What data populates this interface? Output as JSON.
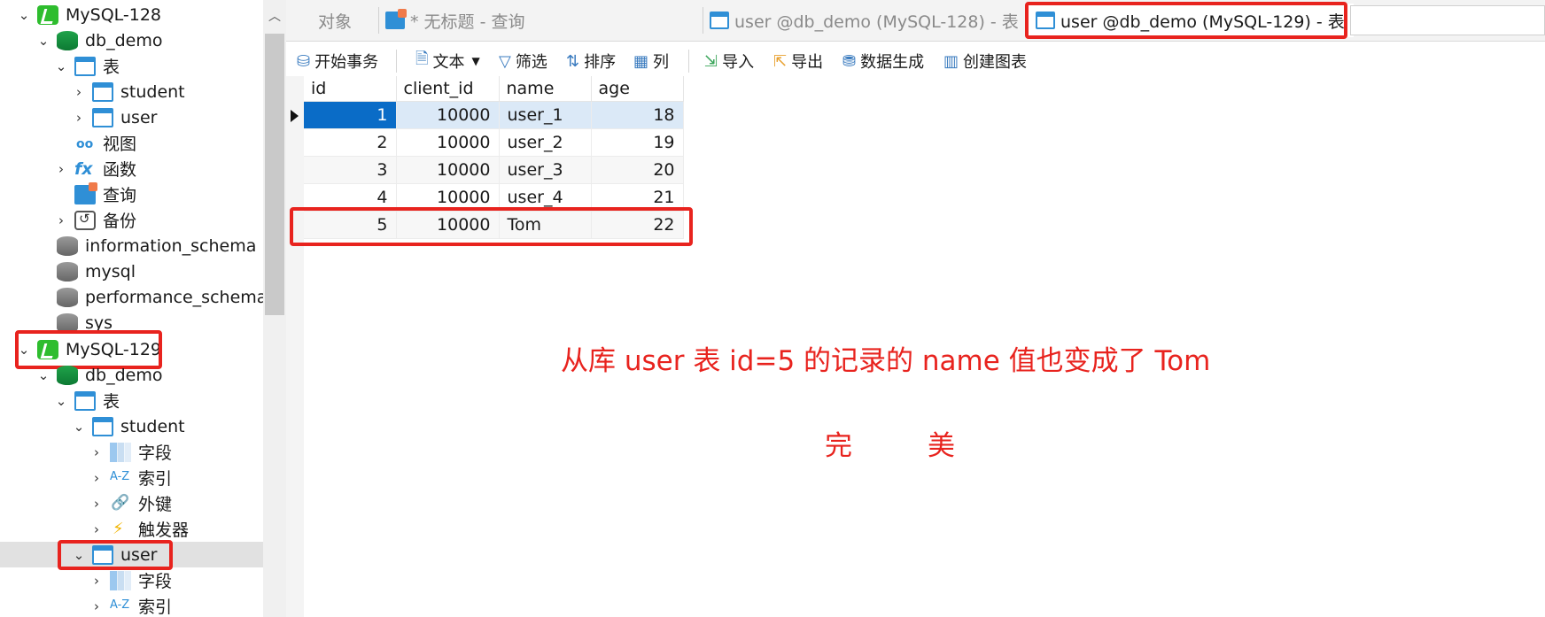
{
  "tree": {
    "conn1": "MySQL-128",
    "conn1_db": "db_demo",
    "tables": "表",
    "t_student": "student",
    "t_user": "user",
    "views": "视图",
    "functions": "函数",
    "queries": "查询",
    "backups": "备份",
    "db_info": "information_schema",
    "db_mysql": "mysql",
    "db_perf": "performance_schema",
    "db_sys": "sys",
    "conn2": "MySQL-129",
    "conn2_db": "db_demo",
    "tables2": "表",
    "t2_student": "student",
    "fields": "字段",
    "indexes": "索引",
    "foreign_keys": "外键",
    "triggers": "触发器",
    "t2_user": "user",
    "fields2": "字段",
    "indexes2": "索引"
  },
  "tabs": {
    "objects": "对象",
    "query": "* 无标题 - 查询",
    "user128": "user @db_demo (MySQL-128) - 表",
    "user129": "user @db_demo (MySQL-129) - 表"
  },
  "toolbar": {
    "begin_tx": "开始事务",
    "text": "文本",
    "filter": "筛选",
    "sort": "排序",
    "columns": "列",
    "import": "导入",
    "export": "导出",
    "datagen": "数据生成",
    "chart": "创建图表"
  },
  "grid": {
    "columns": [
      "id",
      "client_id",
      "name",
      "age"
    ],
    "rows": [
      [
        "1",
        "10000",
        "user_1",
        "18"
      ],
      [
        "2",
        "10000",
        "user_2",
        "19"
      ],
      [
        "3",
        "10000",
        "user_3",
        "20"
      ],
      [
        "4",
        "10000",
        "user_4",
        "21"
      ],
      [
        "5",
        "10000",
        "Tom",
        "22"
      ]
    ]
  },
  "annotation": {
    "line1": "从库 user 表 id=5 的记录的 name 值也变成了 Tom",
    "line2a": "完",
    "line2b": "美"
  },
  "colors": {
    "highlight": "#e8231e",
    "selection": "#0a6cc7",
    "row_current": "#dbe9f7"
  }
}
